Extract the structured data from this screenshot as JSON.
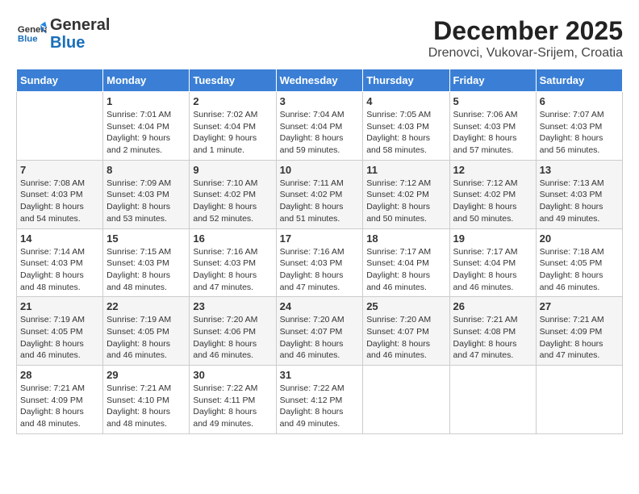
{
  "logo": {
    "line1": "General",
    "line2": "Blue"
  },
  "title": "December 2025",
  "location": "Drenovci, Vukovar-Srijem, Croatia",
  "days_of_week": [
    "Sunday",
    "Monday",
    "Tuesday",
    "Wednesday",
    "Thursday",
    "Friday",
    "Saturday"
  ],
  "weeks": [
    [
      {
        "num": "",
        "sunrise": "",
        "sunset": "",
        "daylight": ""
      },
      {
        "num": "1",
        "sunrise": "7:01 AM",
        "sunset": "4:04 PM",
        "daylight": "9 hours and 2 minutes."
      },
      {
        "num": "2",
        "sunrise": "7:02 AM",
        "sunset": "4:04 PM",
        "daylight": "9 hours and 1 minute."
      },
      {
        "num": "3",
        "sunrise": "7:04 AM",
        "sunset": "4:04 PM",
        "daylight": "8 hours and 59 minutes."
      },
      {
        "num": "4",
        "sunrise": "7:05 AM",
        "sunset": "4:03 PM",
        "daylight": "8 hours and 58 minutes."
      },
      {
        "num": "5",
        "sunrise": "7:06 AM",
        "sunset": "4:03 PM",
        "daylight": "8 hours and 57 minutes."
      },
      {
        "num": "6",
        "sunrise": "7:07 AM",
        "sunset": "4:03 PM",
        "daylight": "8 hours and 56 minutes."
      }
    ],
    [
      {
        "num": "7",
        "sunrise": "7:08 AM",
        "sunset": "4:03 PM",
        "daylight": "8 hours and 54 minutes."
      },
      {
        "num": "8",
        "sunrise": "7:09 AM",
        "sunset": "4:03 PM",
        "daylight": "8 hours and 53 minutes."
      },
      {
        "num": "9",
        "sunrise": "7:10 AM",
        "sunset": "4:02 PM",
        "daylight": "8 hours and 52 minutes."
      },
      {
        "num": "10",
        "sunrise": "7:11 AM",
        "sunset": "4:02 PM",
        "daylight": "8 hours and 51 minutes."
      },
      {
        "num": "11",
        "sunrise": "7:12 AM",
        "sunset": "4:02 PM",
        "daylight": "8 hours and 50 minutes."
      },
      {
        "num": "12",
        "sunrise": "7:12 AM",
        "sunset": "4:02 PM",
        "daylight": "8 hours and 50 minutes."
      },
      {
        "num": "13",
        "sunrise": "7:13 AM",
        "sunset": "4:03 PM",
        "daylight": "8 hours and 49 minutes."
      }
    ],
    [
      {
        "num": "14",
        "sunrise": "7:14 AM",
        "sunset": "4:03 PM",
        "daylight": "8 hours and 48 minutes."
      },
      {
        "num": "15",
        "sunrise": "7:15 AM",
        "sunset": "4:03 PM",
        "daylight": "8 hours and 48 minutes."
      },
      {
        "num": "16",
        "sunrise": "7:16 AM",
        "sunset": "4:03 PM",
        "daylight": "8 hours and 47 minutes."
      },
      {
        "num": "17",
        "sunrise": "7:16 AM",
        "sunset": "4:03 PM",
        "daylight": "8 hours and 47 minutes."
      },
      {
        "num": "18",
        "sunrise": "7:17 AM",
        "sunset": "4:04 PM",
        "daylight": "8 hours and 46 minutes."
      },
      {
        "num": "19",
        "sunrise": "7:17 AM",
        "sunset": "4:04 PM",
        "daylight": "8 hours and 46 minutes."
      },
      {
        "num": "20",
        "sunrise": "7:18 AM",
        "sunset": "4:05 PM",
        "daylight": "8 hours and 46 minutes."
      }
    ],
    [
      {
        "num": "21",
        "sunrise": "7:19 AM",
        "sunset": "4:05 PM",
        "daylight": "8 hours and 46 minutes."
      },
      {
        "num": "22",
        "sunrise": "7:19 AM",
        "sunset": "4:05 PM",
        "daylight": "8 hours and 46 minutes."
      },
      {
        "num": "23",
        "sunrise": "7:20 AM",
        "sunset": "4:06 PM",
        "daylight": "8 hours and 46 minutes."
      },
      {
        "num": "24",
        "sunrise": "7:20 AM",
        "sunset": "4:07 PM",
        "daylight": "8 hours and 46 minutes."
      },
      {
        "num": "25",
        "sunrise": "7:20 AM",
        "sunset": "4:07 PM",
        "daylight": "8 hours and 46 minutes."
      },
      {
        "num": "26",
        "sunrise": "7:21 AM",
        "sunset": "4:08 PM",
        "daylight": "8 hours and 47 minutes."
      },
      {
        "num": "27",
        "sunrise": "7:21 AM",
        "sunset": "4:09 PM",
        "daylight": "8 hours and 47 minutes."
      }
    ],
    [
      {
        "num": "28",
        "sunrise": "7:21 AM",
        "sunset": "4:09 PM",
        "daylight": "8 hours and 48 minutes."
      },
      {
        "num": "29",
        "sunrise": "7:21 AM",
        "sunset": "4:10 PM",
        "daylight": "8 hours and 48 minutes."
      },
      {
        "num": "30",
        "sunrise": "7:22 AM",
        "sunset": "4:11 PM",
        "daylight": "8 hours and 49 minutes."
      },
      {
        "num": "31",
        "sunrise": "7:22 AM",
        "sunset": "4:12 PM",
        "daylight": "8 hours and 49 minutes."
      },
      {
        "num": "",
        "sunrise": "",
        "sunset": "",
        "daylight": ""
      },
      {
        "num": "",
        "sunrise": "",
        "sunset": "",
        "daylight": ""
      },
      {
        "num": "",
        "sunrise": "",
        "sunset": "",
        "daylight": ""
      }
    ]
  ],
  "labels": {
    "sunrise": "Sunrise:",
    "sunset": "Sunset:",
    "daylight": "Daylight:"
  }
}
